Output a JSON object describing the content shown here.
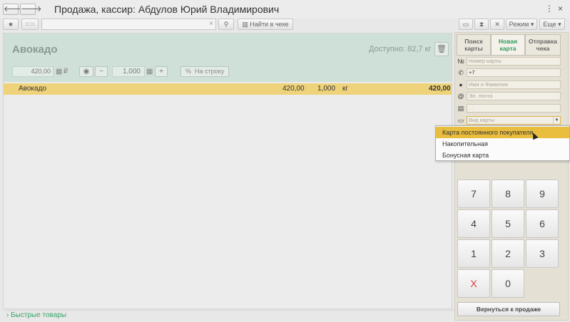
{
  "window": {
    "title": "Продажа, кассир: Абдулов Юрий Владимирович",
    "back_icon": "arrow-left-icon",
    "forward_icon": "arrow-right-icon",
    "menu_icon": "⋮",
    "close_icon": "×"
  },
  "toolbar": {
    "find_check_label": "Найти в чеке",
    "mode_label": "Режим ▾",
    "more_label": "Еще ▾"
  },
  "product": {
    "name": "Авокадо",
    "available": "Доступно: 82,7 кг",
    "price": "420,00",
    "currency": "₽",
    "quantity": "1,000",
    "to_line_label": "На строку"
  },
  "receipt_rows": [
    {
      "name": "Авокадо",
      "price": "420,00",
      "qty": "1,000",
      "unit": "кг",
      "total": "420,00"
    }
  ],
  "quick_items_label": "Быстрые товары",
  "right_panel": {
    "tabs": [
      {
        "label": "Поиск карты",
        "active": false
      },
      {
        "label": "Новая карта",
        "active": true
      },
      {
        "label": "Отправка чека",
        "active": false
      }
    ],
    "fields": {
      "card_number_placeholder": "Номер карты",
      "phone_value": "+7",
      "name_placeholder": "Имя и Фамилия",
      "email_placeholder": "Эл. почта",
      "date_placeholder": ". .",
      "card_type_placeholder": "Вид карты"
    }
  },
  "dropdown": {
    "options": [
      {
        "label": "Карта постоянного покупателя",
        "selected": true
      },
      {
        "label": "Накопительная",
        "selected": false
      },
      {
        "label": "Бонусная карта",
        "selected": false
      }
    ]
  },
  "numpad": {
    "keys": [
      "7",
      "8",
      "9",
      "4",
      "5",
      "6",
      "1",
      "2",
      "3",
      "X",
      "0"
    ]
  },
  "back_to_sale_label": "Вернуться к продаже",
  "colors": {
    "accent_green": "#37a46a",
    "selected_row": "#efd37a",
    "dropdown_highlight": "#e9bd3e",
    "clear_key": "#e03a3a"
  }
}
